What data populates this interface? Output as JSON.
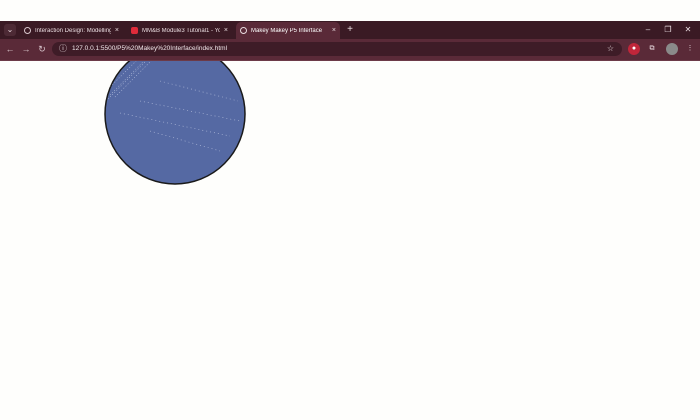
{
  "browser": {
    "tabs": [
      {
        "title": "Interaction Design: Modelling",
        "favicon": "globe-icon",
        "active": false
      },
      {
        "title": "MM&B Module3 Tutorial1 - Yo",
        "favicon": "youtube-icon",
        "active": false
      },
      {
        "title": "Makey Makey P5 Interface",
        "favicon": "globe-icon",
        "active": true
      }
    ],
    "address": "127.0.0.1:5500/P5%20Makey%20Interface/index.html",
    "colors": {
      "frame": "#3a1a24",
      "toolbar": "#5a2a38",
      "omnibox": "#3e1c27"
    }
  },
  "canvas": {
    "background": "#fefefc",
    "circle_fill": "#5569a3",
    "circle_stroke": "#1a1a1a"
  }
}
